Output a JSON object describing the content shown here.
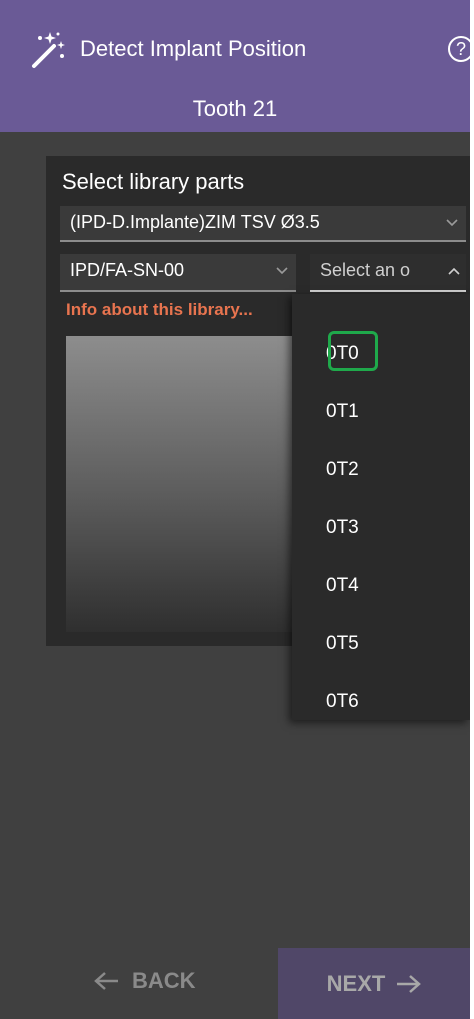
{
  "header": {
    "title": "Detect Implant Position",
    "help_symbol": "?",
    "subtitle": "Tooth 21"
  },
  "panel": {
    "title": "Select library parts",
    "library_select": {
      "value": "(IPD-D.Implante)ZIM TSV Ø3.5"
    },
    "part_select": {
      "value": "IPD/FA-SN-00"
    },
    "option_select": {
      "placeholder": "Select an o"
    },
    "info_link": "Info about this library..."
  },
  "dropdown": {
    "options": [
      "0T0",
      "0T1",
      "0T2",
      "0T3",
      "0T4",
      "0T5",
      "0T6"
    ],
    "highlighted": "0T0"
  },
  "footer": {
    "back_label": "BACK",
    "next_label": "NEXT"
  },
  "colors": {
    "header_bg": "#6a5a96",
    "app_bg": "#404040",
    "panel_bg": "#2a2a2a",
    "info_link": "#e8744f",
    "highlight": "#1fa94b",
    "next_button_bg": "#504768"
  },
  "icons": {
    "title": "magic-wand-icon",
    "help": "help-icon",
    "back": "arrow-left-icon",
    "next": "arrow-right-icon"
  }
}
